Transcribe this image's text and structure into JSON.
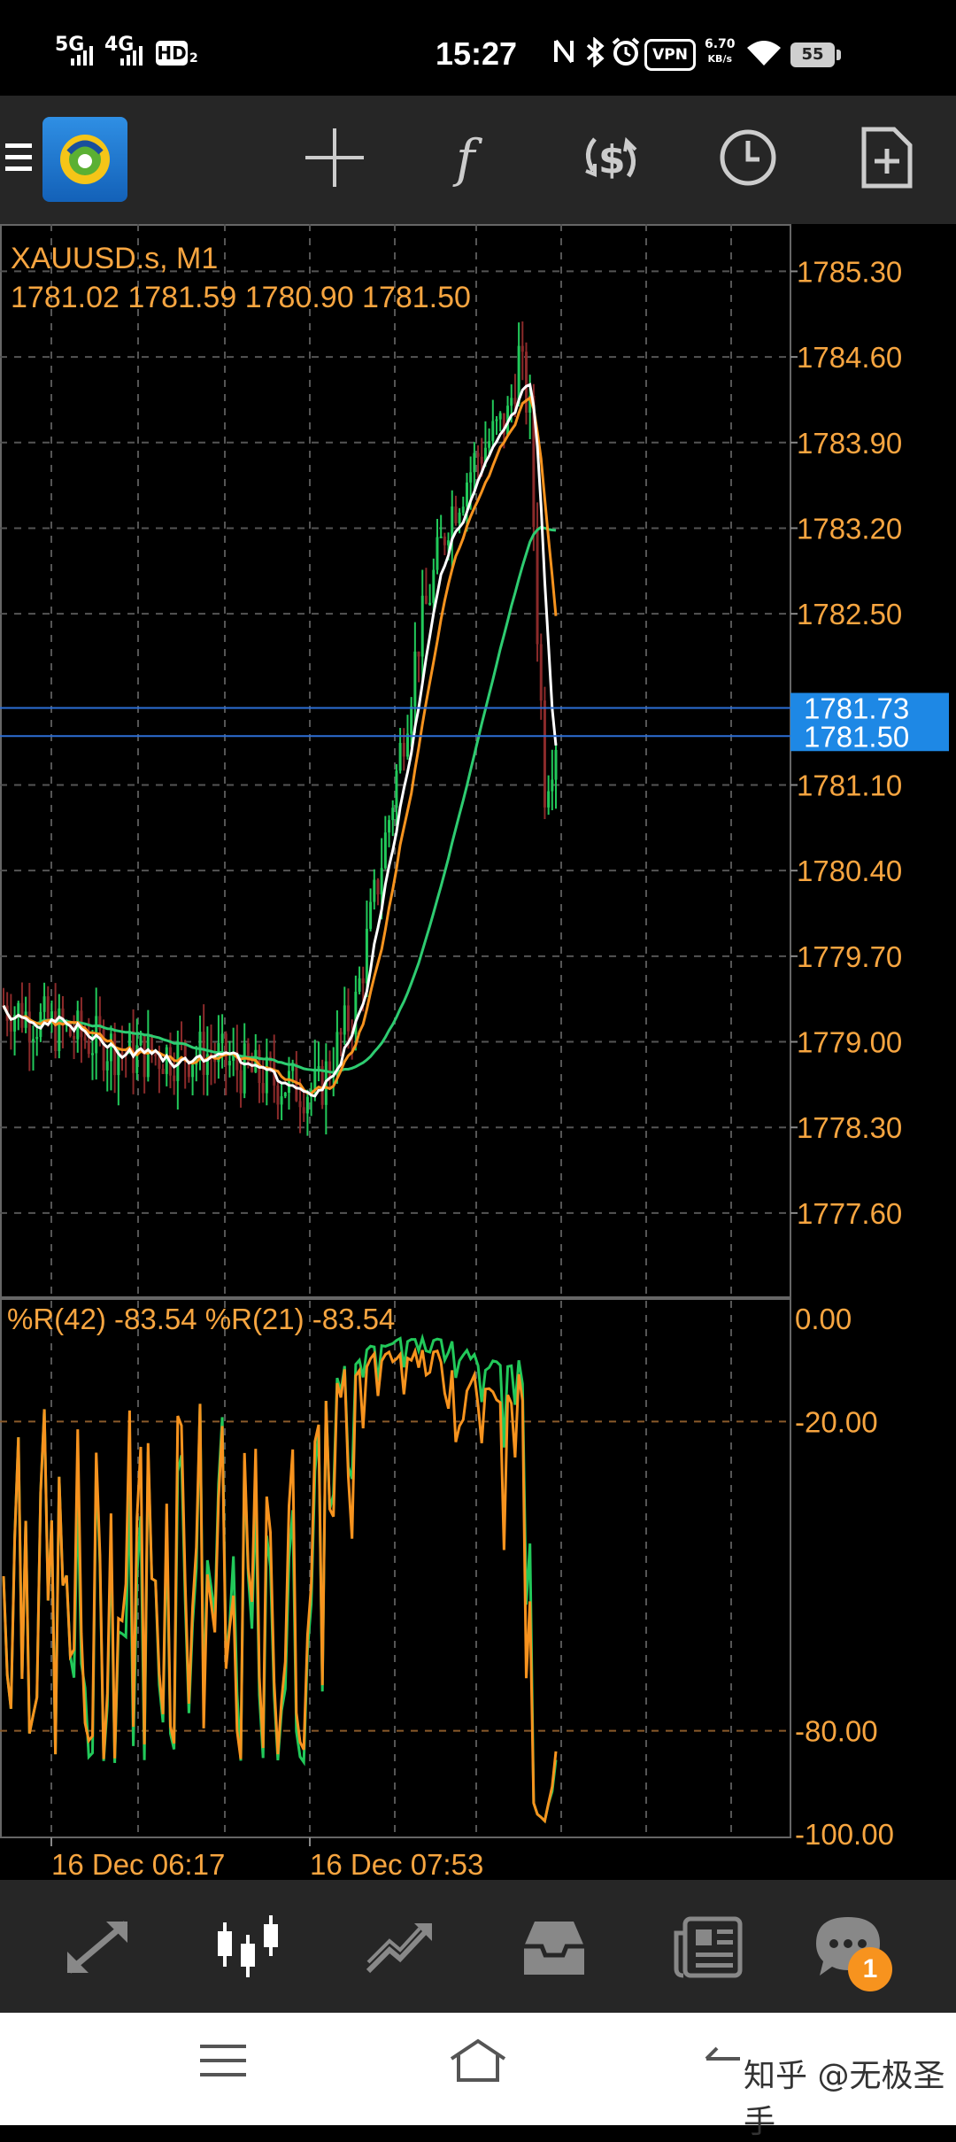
{
  "status_bar": {
    "time": "15:27",
    "net1": "5G",
    "net2": "4G",
    "hd": "HD",
    "hd_sub": "2",
    "vpn": "VPN",
    "speed_value": "6.70",
    "speed_unit": "KB/s",
    "battery": "55",
    "icons": [
      "nfc-icon",
      "bluetooth-icon",
      "alarm-icon",
      "wifi-icon"
    ]
  },
  "toolbar": {
    "icons": [
      "menu-icon",
      "metatrader-logo",
      "crosshair-icon",
      "indicators-icon",
      "symbol-change-icon",
      "timeframe-icon",
      "new-order-icon"
    ]
  },
  "chart": {
    "symbol": "XAUUSD.s, M1",
    "ohlc": "1781.02 1781.59 1780.90 1781.50",
    "price_labels": [
      "1785.30",
      "1784.60",
      "1783.90",
      "1783.20",
      "1782.50",
      "1781.10",
      "1780.40",
      "1779.70",
      "1779.00",
      "1778.30",
      "1777.60"
    ],
    "ask_label": "1781.73",
    "bid_label": "1781.50",
    "wpr_label": "%R(42) -83.54 %R(21) -83.54",
    "wpr_levels": [
      "0.00",
      "-20.00",
      "-80.00",
      "-100.00"
    ],
    "time_labels": [
      "16 Dec 06:17",
      "16 Dec 07:53"
    ],
    "colors": {
      "text": "#f7a540",
      "grid": "#555555",
      "bull": "#22c95a",
      "bear": "#8b2a2a",
      "ma_white": "#ffffff",
      "ma_orange": "#f7931e",
      "ma_green": "#2ecc71",
      "price_line": "#2d6fd6",
      "price_tag": "#1e88e5"
    }
  },
  "bottom_nav": {
    "items": [
      "quotes-icon",
      "chart-icon",
      "trade-icon",
      "history-icon",
      "news-icon",
      "messages-icon"
    ],
    "badge": "1"
  },
  "system_nav": {
    "watermark": "知乎 @无极圣手"
  }
}
